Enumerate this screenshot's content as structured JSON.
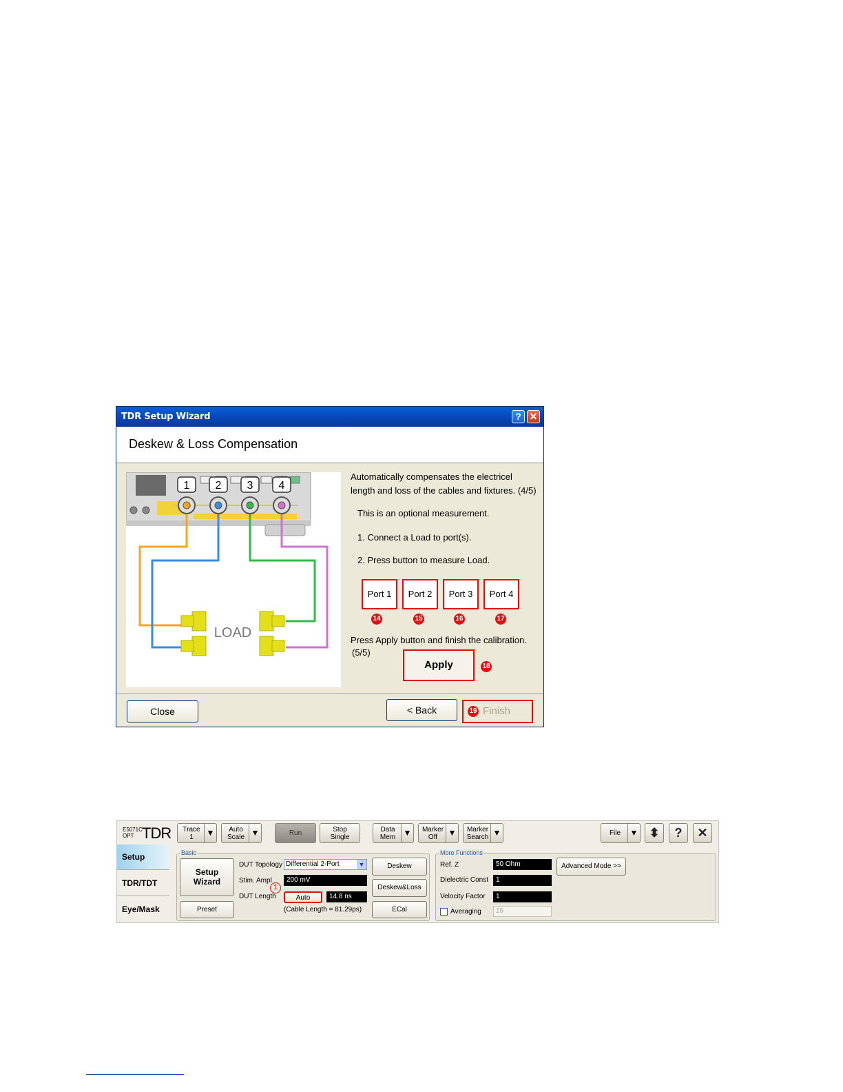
{
  "wizard": {
    "title": "TDR Setup Wizard",
    "help_glyph": "?",
    "close_glyph": "✕",
    "heading": "Deskew & Loss Compensation",
    "port_labels": [
      "1",
      "2",
      "3",
      "4"
    ],
    "load_label": "LOAD",
    "colors": {
      "port1": "#f5a623",
      "port2": "#3a8ddc",
      "port3": "#33b84a",
      "port4": "#d070d0",
      "load": "#e3df1a",
      "highlight": "#e01010"
    },
    "intro_line1": "Automatically compensates the electricel",
    "intro_line2": "length and loss of the cables and fixtures.  (4/5)",
    "optional": "This is an optional measurement.",
    "step1": "1. Connect a Load to port(s).",
    "step2": "2. Press button to measure Load.",
    "port_buttons": [
      {
        "label": "Port 1",
        "marker": "14"
      },
      {
        "label": "Port 2",
        "marker": "15"
      },
      {
        "label": "Port 3",
        "marker": "16"
      },
      {
        "label": "Port 4",
        "marker": "17"
      }
    ],
    "apply_note_line1": "Press Apply button and finish the calibration.",
    "apply_note_line2": "(5/5)",
    "apply_label": "Apply",
    "apply_marker": "18",
    "close_label": "Close",
    "back_label": "< Back",
    "finish_label": "Finish",
    "finish_marker": "19"
  },
  "tdr": {
    "logo_small_1": "E5071C",
    "logo_small_2": "OPT",
    "logo_big": "TDR",
    "toolbar": {
      "trace": [
        "Trace",
        "1"
      ],
      "auto_scale": [
        "Auto",
        "Scale"
      ],
      "run": "Run",
      "stop_single": [
        "Stop",
        "Single"
      ],
      "data_mem": [
        "Data",
        "Mem"
      ],
      "marker_off": [
        "Marker",
        "Off"
      ],
      "marker_search": [
        "Marker",
        "Search"
      ],
      "file": "File",
      "dropdown_glyph": "▼",
      "updown_glyph": "⬍",
      "help_glyph": "?",
      "close_glyph": "✕"
    },
    "tabs": [
      "Setup",
      "TDR/TDT",
      "Eye/Mask"
    ],
    "basic": {
      "group_label": "Basic",
      "setup_wizard": [
        "Setup",
        "Wizard"
      ],
      "preset": "Preset",
      "dut_topology_label": "DUT Topology",
      "dut_topology_value": "Differential 2-Port",
      "stim_ampl_label": "Stim. Ampl",
      "stim_ampl_value": "200 mV",
      "dut_length_label": "DUT Length",
      "auto_label": "Auto",
      "auto_marker": "1",
      "dut_length_value": "14.8 ns",
      "cable_length_note": "(Cable Length =  81.29ps)",
      "deskew": "Deskew",
      "deskew_loss": "Deskew&Loss",
      "ecal": "ECal"
    },
    "more": {
      "group_label": "More Functions",
      "ref_z_label": "Ref. Z",
      "ref_z_value": "50 Ohm",
      "dielectric_label": "Dielectric Const",
      "dielectric_value": "1",
      "velocity_label": "Velocity Factor",
      "velocity_value": "1",
      "averaging_label": "Averaging",
      "averaging_value": "16",
      "advanced_mode": "Advanced Mode >>"
    }
  }
}
